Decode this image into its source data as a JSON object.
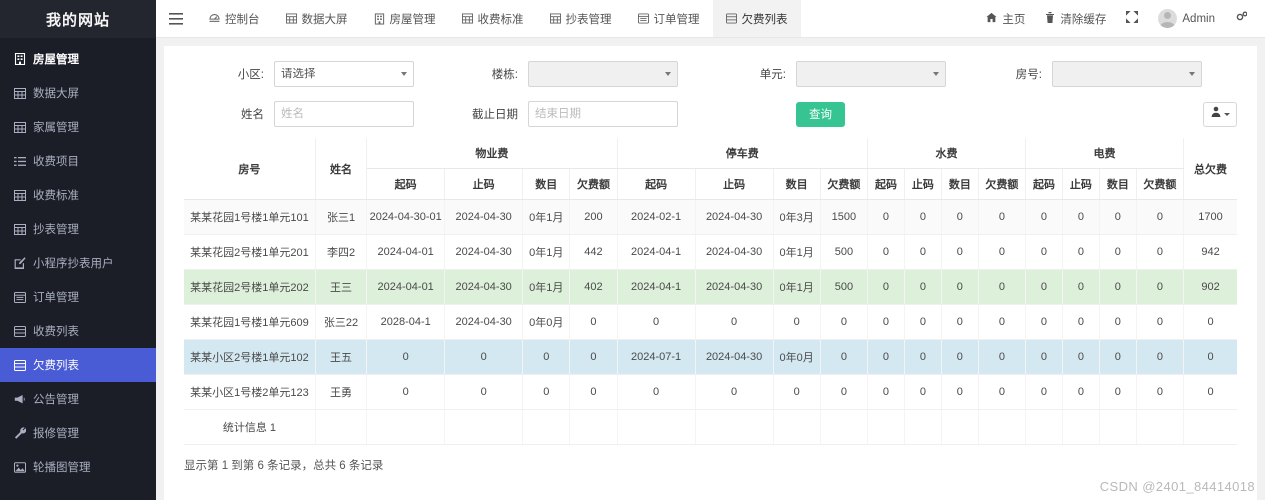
{
  "brand": {
    "title": "我的网站"
  },
  "sidebar": {
    "items": [
      {
        "label": "房屋管理",
        "icon": "building-icon",
        "active": false,
        "bold": true
      },
      {
        "label": "数据大屏",
        "icon": "grid-icon",
        "active": false
      },
      {
        "label": "家属管理",
        "icon": "grid-icon",
        "active": false
      },
      {
        "label": "收费项目",
        "icon": "list-icon",
        "active": false
      },
      {
        "label": "收费标准",
        "icon": "grid-icon",
        "active": false
      },
      {
        "label": "抄表管理",
        "icon": "grid-icon",
        "active": false
      },
      {
        "label": "小程序抄表用户",
        "icon": "edit-icon",
        "active": false
      },
      {
        "label": "订单管理",
        "icon": "window-icon",
        "active": false
      },
      {
        "label": "收费列表",
        "icon": "table-icon",
        "active": false
      },
      {
        "label": "欠费列表",
        "icon": "table-icon",
        "active": true
      },
      {
        "label": "公告管理",
        "icon": "megaphone-icon",
        "active": false
      },
      {
        "label": "报修管理",
        "icon": "wrench-icon",
        "active": false
      },
      {
        "label": "轮播图管理",
        "icon": "image-icon",
        "active": false
      }
    ]
  },
  "topbar": {
    "menu_icon": "hamburger-icon",
    "tabs": [
      {
        "label": "控制台",
        "icon": "dashboard-icon",
        "active": false
      },
      {
        "label": "数据大屏",
        "icon": "grid-icon",
        "active": false
      },
      {
        "label": "房屋管理",
        "icon": "building-icon",
        "active": false
      },
      {
        "label": "收费标准",
        "icon": "grid-icon",
        "active": false
      },
      {
        "label": "抄表管理",
        "icon": "grid-icon",
        "active": false
      },
      {
        "label": "订单管理",
        "icon": "window-icon",
        "active": false
      },
      {
        "label": "欠费列表",
        "icon": "table-icon",
        "active": true
      }
    ],
    "right": {
      "home_label": "主页",
      "home_icon": "home-icon",
      "clear_cache_label": "清除缓存",
      "clear_cache_icon": "trash-icon",
      "fullscreen_icon": "fullscreen-icon",
      "user_name": "Admin",
      "avatar_icon": "avatar-icon",
      "settings_icon": "gear-icon"
    }
  },
  "filters": {
    "community": {
      "label": "小区:",
      "value": "请选择"
    },
    "building": {
      "label": "楼栋:",
      "value": ""
    },
    "unit": {
      "label": "单元:",
      "value": ""
    },
    "room": {
      "label": "房号:",
      "value": ""
    },
    "name": {
      "label": "姓名",
      "value": "",
      "placeholder": "姓名"
    },
    "end_date": {
      "label": "截止日期",
      "value": "",
      "placeholder": "结束日期"
    },
    "search_button": "查询",
    "export_icon": "export-icon"
  },
  "table": {
    "headers": {
      "room": "房号",
      "name": "姓名",
      "groups": [
        {
          "title": "物业费",
          "subs": [
            "起码",
            "止码",
            "数目",
            "欠费额"
          ]
        },
        {
          "title": "停车费",
          "subs": [
            "起码",
            "止码",
            "数目",
            "欠费额"
          ]
        },
        {
          "title": "水费",
          "subs": [
            "起码",
            "止码",
            "数目",
            "欠费额"
          ]
        },
        {
          "title": "电费",
          "subs": [
            "起码",
            "止码",
            "数目",
            "欠费额"
          ]
        }
      ],
      "total": "总欠费"
    },
    "rows": [
      {
        "shade": "a",
        "cells": [
          "某某花园1号楼1单元101",
          "张三1",
          "2024-04-30-01",
          "2024-04-30",
          "0年1月",
          "200",
          "2024-02-1",
          "2024-04-30",
          "0年3月",
          "1500",
          "0",
          "0",
          "0",
          "0",
          "0",
          "0",
          "0",
          "0",
          "1700"
        ]
      },
      {
        "shade": "none",
        "cells": [
          "某某花园2号楼1单元201",
          "李四2",
          "2024-04-01",
          "2024-04-30",
          "0年1月",
          "442",
          "2024-04-1",
          "2024-04-30",
          "0年1月",
          "500",
          "0",
          "0",
          "0",
          "0",
          "0",
          "0",
          "0",
          "0",
          "942"
        ]
      },
      {
        "shade": "green",
        "cells": [
          "某某花园2号楼1单元202",
          "王三",
          "2024-04-01",
          "2024-04-30",
          "0年1月",
          "402",
          "2024-04-1",
          "2024-04-30",
          "0年1月",
          "500",
          "0",
          "0",
          "0",
          "0",
          "0",
          "0",
          "0",
          "0",
          "902"
        ]
      },
      {
        "shade": "none",
        "cells": [
          "某某花园1号楼1单元609",
          "张三22",
          "2028-04-1",
          "2024-04-30",
          "0年0月",
          "0",
          "0",
          "0",
          "0",
          "0",
          "0",
          "0",
          "0",
          "0",
          "0",
          "0",
          "0",
          "0",
          "0"
        ]
      },
      {
        "shade": "blue",
        "cells": [
          "某某小区2号楼1单元102",
          "王五",
          "0",
          "0",
          "0",
          "0",
          "2024-07-1",
          "2024-04-30",
          "0年0月",
          "0",
          "0",
          "0",
          "0",
          "0",
          "0",
          "0",
          "0",
          "0",
          "0"
        ]
      },
      {
        "shade": "none",
        "cells": [
          "某某小区1号楼2单元123",
          "王勇",
          "0",
          "0",
          "0",
          "0",
          "0",
          "0",
          "0",
          "0",
          "0",
          "0",
          "0",
          "0",
          "0",
          "0",
          "0",
          "0",
          "0"
        ]
      }
    ],
    "summary_label": "统计信息 1",
    "page_info": "显示第 1 到第 6 条记录，总共 6 条记录"
  },
  "watermark": "CSDN @2401_84414018",
  "colors": {
    "sidebar_bg": "#1b1e27",
    "sidebar_active": "#4a5bd6",
    "search_green": "#36c493",
    "row_green": "#ddf0da",
    "row_blue": "#d4e8f2"
  }
}
